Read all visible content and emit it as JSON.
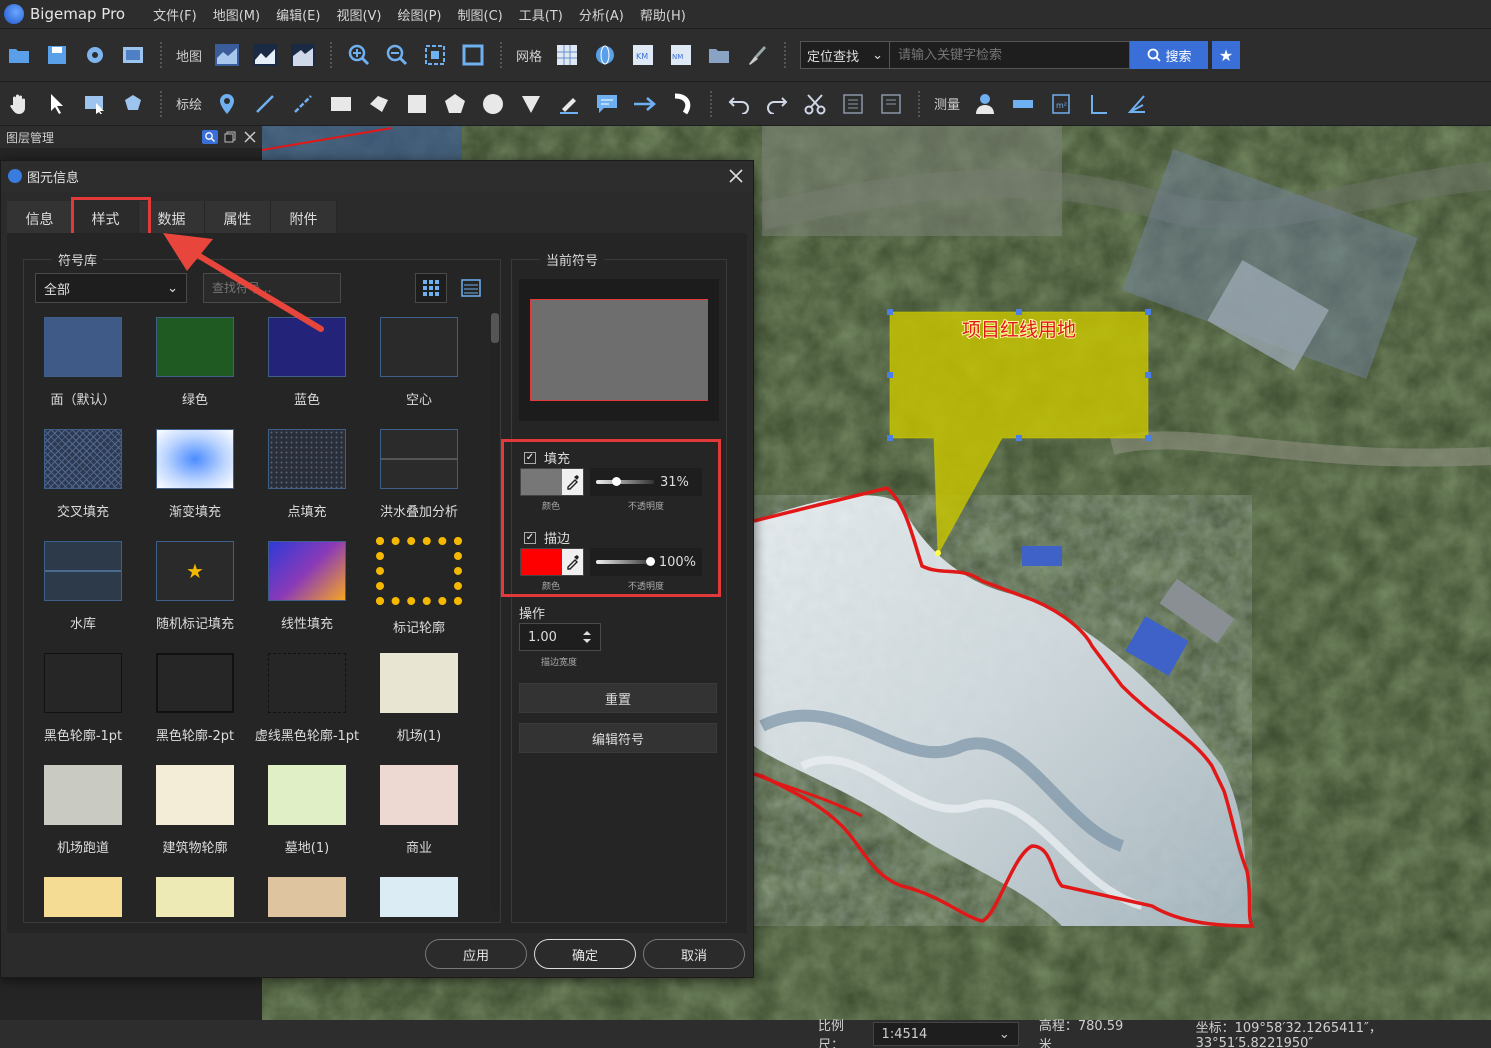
{
  "app": {
    "title": "Bigemap Pro"
  },
  "menu": [
    "文件(F)",
    "地图(M)",
    "编辑(E)",
    "视图(V)",
    "绘图(P)",
    "制图(C)",
    "工具(T)",
    "分析(A)",
    "帮助(H)"
  ],
  "toolbar1": {
    "map_label": "地图",
    "grid_label": "网格",
    "search_mode": "定位查找",
    "search_placeholder": "请输入关键字检索",
    "search_button": "搜索"
  },
  "toolbar2": {
    "annotate_label": "标绘",
    "measure_label": "测量"
  },
  "layer_panel": {
    "title": "图层管理"
  },
  "dialog": {
    "title": "图元信息",
    "tabs": [
      "信息",
      "样式",
      "数据",
      "属性",
      "附件"
    ],
    "active_tab": "样式",
    "symbol_library": {
      "title": "符号库",
      "category": "全部",
      "search_placeholder": "查找符号...",
      "symbols": [
        {
          "label": "面（默认）",
          "color": "#3f5a86"
        },
        {
          "label": "绿色",
          "color": "#1f5a23"
        },
        {
          "label": "蓝色",
          "color": "#23237a"
        },
        {
          "label": "空心",
          "color": "#2a2a2a"
        },
        {
          "label": "交叉填充",
          "color": "#34425e"
        },
        {
          "label": "渐变填充",
          "color": "#5e9bff"
        },
        {
          "label": "点填充",
          "color": "#2c3140"
        },
        {
          "label": "洪水叠加分析",
          "color": "#2b2b2b"
        },
        {
          "label": "水库",
          "color": "#2d3a4a"
        },
        {
          "label": "随机标记填充",
          "color": "#2a2a2a"
        },
        {
          "label": "线性填充",
          "color": "#5b3bd0"
        },
        {
          "label": "标记轮廓",
          "color": "#f5b800"
        },
        {
          "label": "黑色轮廓-1pt",
          "color": "#262626"
        },
        {
          "label": "黑色轮廓-2pt",
          "color": "#262626"
        },
        {
          "label": "虚线黑色轮廓-1pt",
          "color": "#262626"
        },
        {
          "label": "机场(1)",
          "color": "#e8e6d2"
        },
        {
          "label": "机场跑道",
          "color": "#c9cac2"
        },
        {
          "label": "建筑物轮廓",
          "color": "#f3ecd6"
        },
        {
          "label": "墓地(1)",
          "color": "#e0efc6"
        },
        {
          "label": "商业",
          "color": "#eed9d2"
        },
        {
          "label": "",
          "color": "#f5dc95"
        },
        {
          "label": "",
          "color": "#eeeab6"
        },
        {
          "label": "",
          "color": "#dfc4a0"
        },
        {
          "label": "",
          "color": "#dcecf4"
        }
      ]
    },
    "current_symbol": {
      "title": "当前符号",
      "fill_color": "#6e6e6e",
      "stroke_color": "#e23a3a"
    },
    "fill": {
      "label": "填充",
      "checked": true,
      "color": "#777777",
      "color_label": "颜色",
      "opacity": "31%",
      "opacity_value": 0.31,
      "opacity_label": "不透明度"
    },
    "stroke": {
      "label": "描边",
      "checked": true,
      "color": "#ff0000",
      "color_label": "颜色",
      "opacity": "100%",
      "opacity_value": 1.0,
      "opacity_label": "不透明度"
    },
    "operation": {
      "title": "操作",
      "stroke_width": "1.00",
      "stroke_width_label": "描边宽度"
    },
    "buttons": {
      "reset": "重置",
      "edit_symbol": "编辑符号",
      "apply": "应用",
      "ok": "确定",
      "cancel": "取消"
    }
  },
  "map": {
    "callout_label": "项目红线用地"
  },
  "statusbar": {
    "scale_label": "比例尺：",
    "scale_value": "1:4514",
    "elevation": "高程：780.59 米",
    "coordinates": "坐标：109°58′32.1265411″，33°51′5.8221950″"
  }
}
